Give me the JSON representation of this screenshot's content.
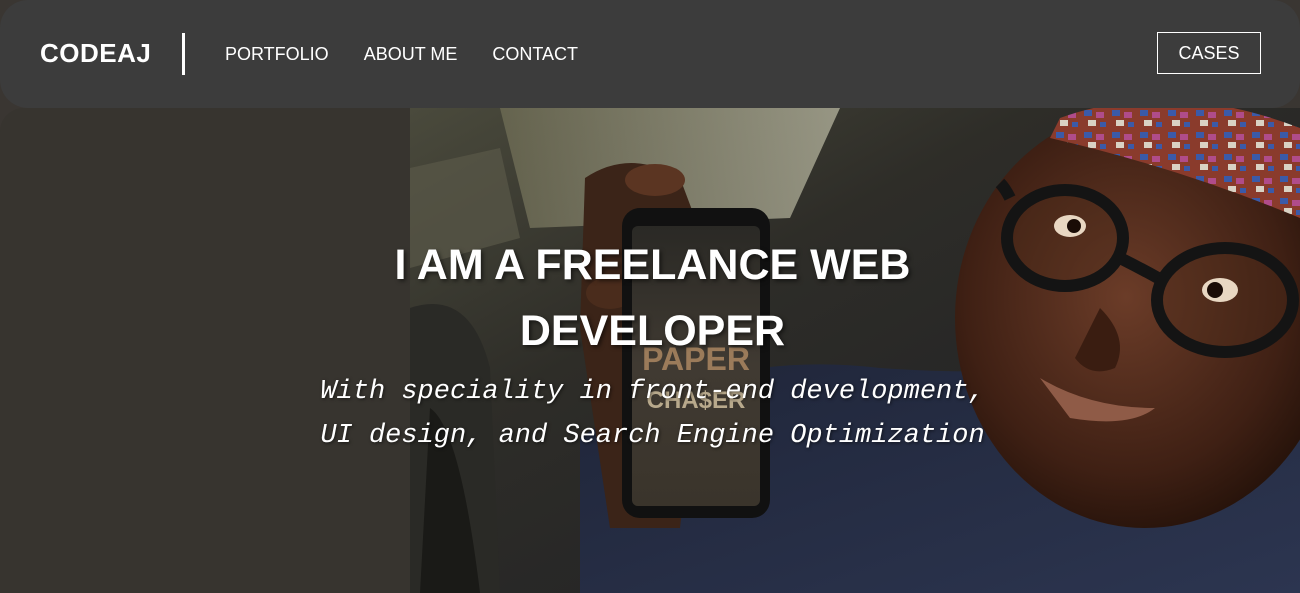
{
  "nav": {
    "brand": "CODEAJ",
    "links": [
      "PORTFOLIO",
      "ABOUT ME",
      "CONTACT"
    ],
    "cta_label": "CASES"
  },
  "hero": {
    "headline": "I AM A FREELANCE WEB DEVELOPER",
    "subline": "With speciality in front-end development, UI design, and Search Engine Optimization",
    "photo": {
      "icon": "portrait-photo",
      "phone_screen_text_1": "PAPER",
      "phone_screen_text_2": "CHA$ER"
    }
  },
  "colors": {
    "navbar_bg": "#3c3c3c",
    "hero_left_bg": "#37342f",
    "text": "#ffffff"
  }
}
